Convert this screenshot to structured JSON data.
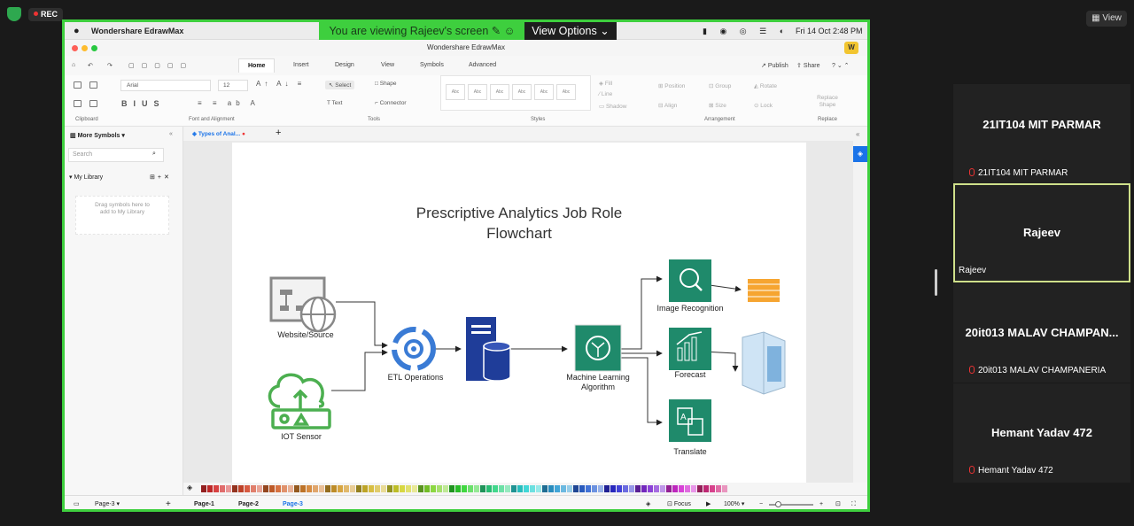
{
  "zoom": {
    "rec_label": "REC",
    "view_label": "View",
    "banner_text": "You are viewing Rajeev's screen",
    "view_options_label": "View Options"
  },
  "macbar": {
    "app_name": "Wondershare EdrawMax",
    "datetime": "Fri 14 Oct  2:48 PM"
  },
  "window": {
    "title": "Wondershare EdrawMax",
    "avatar_letter": "W"
  },
  "tabs": [
    "Home",
    "Insert",
    "Design",
    "View",
    "Symbols",
    "Advanced"
  ],
  "tab_actions": {
    "publish": "Publish",
    "share": "Share"
  },
  "ribbon": {
    "font_name": "Arial",
    "font_size": "12",
    "select": "Select",
    "shape": "Shape",
    "text": "Text",
    "connector": "Connector",
    "style_sample": "Abc",
    "fill": "Fill",
    "line": "Line",
    "shadow": "Shadow",
    "position": "Position",
    "group": "Group",
    "rotate": "Rotate",
    "align": "Align",
    "size": "Size",
    "lock": "Lock",
    "replace_shape": "Replace Shape",
    "groups": [
      "Clipboard",
      "Font and Alignment",
      "Tools",
      "Styles",
      "Arrangement",
      "Replace"
    ]
  },
  "left_panel": {
    "title": "More Symbols",
    "search_placeholder": "Search",
    "library": "My Library",
    "drag_hint": "Drag symbols here to add to My Library"
  },
  "doc_tab": "Types of Anal...",
  "flowchart": {
    "title_line1": "Prescriptive Analytics Job Role",
    "title_line2": "Flowchart",
    "nodes": {
      "website": "Website/Source",
      "iot": "IOT Sensor",
      "etl": "ETL Operations",
      "ml_line1": "Machine Learning",
      "ml_line2": "Algorithm",
      "image_rec": "Image Recognition",
      "forecast": "Forecast",
      "translate": "Translate"
    }
  },
  "statusbar": {
    "page_selector": "Page-3",
    "pages": [
      "Page-1",
      "Page-2",
      "Page-3"
    ],
    "focus": "Focus",
    "zoom": "100%"
  },
  "participants": [
    {
      "display": "21IT104 MIT PARMAR",
      "name": "21IT104 MIT PARMAR",
      "muted": true
    },
    {
      "display": "Rajeev",
      "name": "Rajeev",
      "muted": false
    },
    {
      "display": "20it013 MALAV CHAMPAN...",
      "name": "20it013 MALAV CHAMPANERIA",
      "muted": true
    },
    {
      "display": "Hemant Yadav 472",
      "name": "Hemant Yadav 472",
      "muted": true
    }
  ],
  "colors": {
    "share_border": "#3ecf3e",
    "icon_teal": "#1f8a6b",
    "etl_blue": "#3a7bd5",
    "server_navy": "#1f3d99",
    "active_tab": "#1a73e8"
  }
}
